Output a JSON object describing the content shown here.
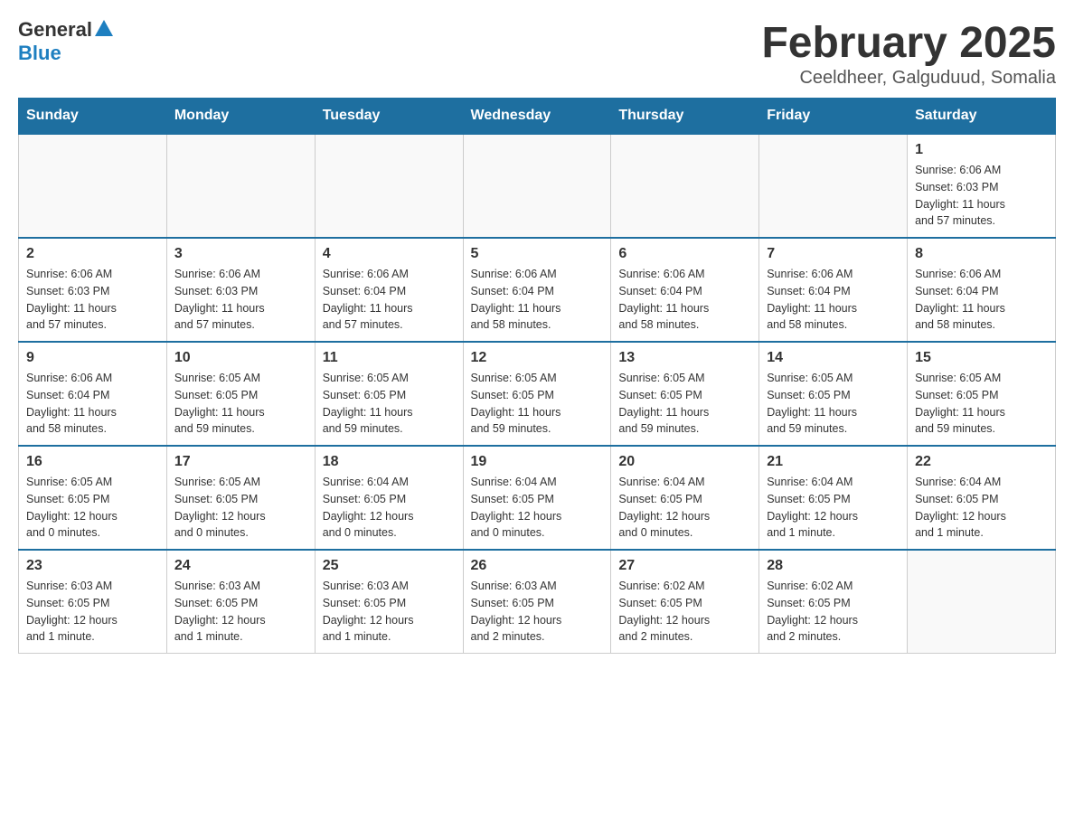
{
  "header": {
    "logo_general": "General",
    "logo_blue": "Blue",
    "month_title": "February 2025",
    "location": "Ceeldheer, Galguduud, Somalia"
  },
  "weekdays": [
    "Sunday",
    "Monday",
    "Tuesday",
    "Wednesday",
    "Thursday",
    "Friday",
    "Saturday"
  ],
  "weeks": [
    [
      {
        "day": "",
        "info": ""
      },
      {
        "day": "",
        "info": ""
      },
      {
        "day": "",
        "info": ""
      },
      {
        "day": "",
        "info": ""
      },
      {
        "day": "",
        "info": ""
      },
      {
        "day": "",
        "info": ""
      },
      {
        "day": "1",
        "info": "Sunrise: 6:06 AM\nSunset: 6:03 PM\nDaylight: 11 hours\nand 57 minutes."
      }
    ],
    [
      {
        "day": "2",
        "info": "Sunrise: 6:06 AM\nSunset: 6:03 PM\nDaylight: 11 hours\nand 57 minutes."
      },
      {
        "day": "3",
        "info": "Sunrise: 6:06 AM\nSunset: 6:03 PM\nDaylight: 11 hours\nand 57 minutes."
      },
      {
        "day": "4",
        "info": "Sunrise: 6:06 AM\nSunset: 6:04 PM\nDaylight: 11 hours\nand 57 minutes."
      },
      {
        "day": "5",
        "info": "Sunrise: 6:06 AM\nSunset: 6:04 PM\nDaylight: 11 hours\nand 58 minutes."
      },
      {
        "day": "6",
        "info": "Sunrise: 6:06 AM\nSunset: 6:04 PM\nDaylight: 11 hours\nand 58 minutes."
      },
      {
        "day": "7",
        "info": "Sunrise: 6:06 AM\nSunset: 6:04 PM\nDaylight: 11 hours\nand 58 minutes."
      },
      {
        "day": "8",
        "info": "Sunrise: 6:06 AM\nSunset: 6:04 PM\nDaylight: 11 hours\nand 58 minutes."
      }
    ],
    [
      {
        "day": "9",
        "info": "Sunrise: 6:06 AM\nSunset: 6:04 PM\nDaylight: 11 hours\nand 58 minutes."
      },
      {
        "day": "10",
        "info": "Sunrise: 6:05 AM\nSunset: 6:05 PM\nDaylight: 11 hours\nand 59 minutes."
      },
      {
        "day": "11",
        "info": "Sunrise: 6:05 AM\nSunset: 6:05 PM\nDaylight: 11 hours\nand 59 minutes."
      },
      {
        "day": "12",
        "info": "Sunrise: 6:05 AM\nSunset: 6:05 PM\nDaylight: 11 hours\nand 59 minutes."
      },
      {
        "day": "13",
        "info": "Sunrise: 6:05 AM\nSunset: 6:05 PM\nDaylight: 11 hours\nand 59 minutes."
      },
      {
        "day": "14",
        "info": "Sunrise: 6:05 AM\nSunset: 6:05 PM\nDaylight: 11 hours\nand 59 minutes."
      },
      {
        "day": "15",
        "info": "Sunrise: 6:05 AM\nSunset: 6:05 PM\nDaylight: 11 hours\nand 59 minutes."
      }
    ],
    [
      {
        "day": "16",
        "info": "Sunrise: 6:05 AM\nSunset: 6:05 PM\nDaylight: 12 hours\nand 0 minutes."
      },
      {
        "day": "17",
        "info": "Sunrise: 6:05 AM\nSunset: 6:05 PM\nDaylight: 12 hours\nand 0 minutes."
      },
      {
        "day": "18",
        "info": "Sunrise: 6:04 AM\nSunset: 6:05 PM\nDaylight: 12 hours\nand 0 minutes."
      },
      {
        "day": "19",
        "info": "Sunrise: 6:04 AM\nSunset: 6:05 PM\nDaylight: 12 hours\nand 0 minutes."
      },
      {
        "day": "20",
        "info": "Sunrise: 6:04 AM\nSunset: 6:05 PM\nDaylight: 12 hours\nand 0 minutes."
      },
      {
        "day": "21",
        "info": "Sunrise: 6:04 AM\nSunset: 6:05 PM\nDaylight: 12 hours\nand 1 minute."
      },
      {
        "day": "22",
        "info": "Sunrise: 6:04 AM\nSunset: 6:05 PM\nDaylight: 12 hours\nand 1 minute."
      }
    ],
    [
      {
        "day": "23",
        "info": "Sunrise: 6:03 AM\nSunset: 6:05 PM\nDaylight: 12 hours\nand 1 minute."
      },
      {
        "day": "24",
        "info": "Sunrise: 6:03 AM\nSunset: 6:05 PM\nDaylight: 12 hours\nand 1 minute."
      },
      {
        "day": "25",
        "info": "Sunrise: 6:03 AM\nSunset: 6:05 PM\nDaylight: 12 hours\nand 1 minute."
      },
      {
        "day": "26",
        "info": "Sunrise: 6:03 AM\nSunset: 6:05 PM\nDaylight: 12 hours\nand 2 minutes."
      },
      {
        "day": "27",
        "info": "Sunrise: 6:02 AM\nSunset: 6:05 PM\nDaylight: 12 hours\nand 2 minutes."
      },
      {
        "day": "28",
        "info": "Sunrise: 6:02 AM\nSunset: 6:05 PM\nDaylight: 12 hours\nand 2 minutes."
      },
      {
        "day": "",
        "info": ""
      }
    ]
  ]
}
